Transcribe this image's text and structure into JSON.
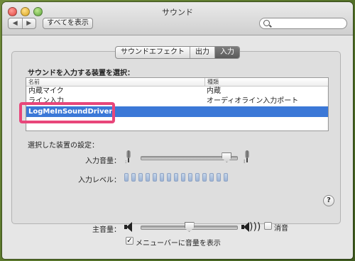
{
  "window": {
    "title": "サウンド"
  },
  "toolbar": {
    "back_glyph": "◀",
    "forward_glyph": "▶",
    "show_all_label": "すべてを表示",
    "search": {
      "value": "",
      "placeholder": ""
    }
  },
  "tabs": [
    {
      "label": "サウンドエフェクト",
      "active": false
    },
    {
      "label": "出力",
      "active": false
    },
    {
      "label": "入力",
      "active": true
    }
  ],
  "input_device": {
    "section_label": "サウンドを入力する装置を選択：",
    "columns": [
      "名前",
      "種類"
    ],
    "rows": [
      {
        "name": "内蔵マイク",
        "type": "内蔵"
      },
      {
        "name": "ライン入力",
        "type": "オーディオライン入力ポート"
      },
      {
        "name": "LogMeInSoundDriver",
        "type": "",
        "selected": true
      }
    ]
  },
  "selected_settings": {
    "label": "選択した装置の設定：",
    "input_volume_label": "入力音量：",
    "input_volume_level": 0.93,
    "input_level_label": "入力レベル：",
    "input_level_segments": 15
  },
  "output": {
    "volume_label": "主音量：",
    "volume_level": 0.5,
    "mute_label": "消音",
    "mute_checked": false,
    "menu_bar_label": "メニューバーに音量を表示",
    "menu_bar_checked": true,
    "check_glyph": "✓"
  },
  "help_glyph": "?",
  "colors": {
    "selection": "#3b78d7",
    "highlight_box": "#e8467a"
  }
}
